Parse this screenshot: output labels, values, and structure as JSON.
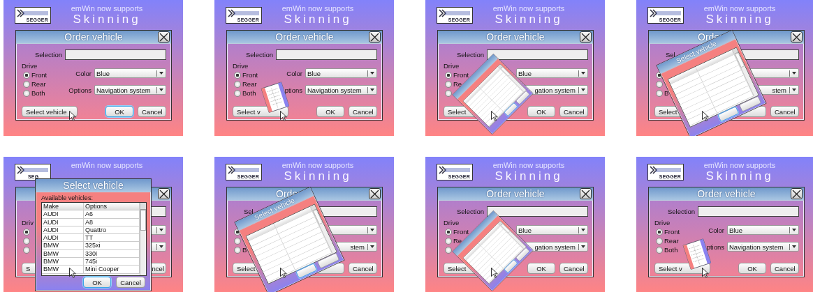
{
  "frames": [
    {
      "header": {
        "logo": "SEGGER",
        "line1": "emWin now supports",
        "line2": "Skinning"
      },
      "dialog": {
        "title": "Order vehicle",
        "selection_label": "Selection",
        "drive_label": "Drive",
        "drive_options": [
          {
            "label": "Front",
            "selected": true
          },
          {
            "label": "Rear",
            "selected": false
          },
          {
            "label": "Both",
            "selected": false
          }
        ],
        "color_label": "Color",
        "color_value": "Blue",
        "options_label": "Options",
        "options_value": "Navigation system",
        "buttons": [
          {
            "kind": "select",
            "label": "Select vehicle",
            "focused": false
          },
          {
            "kind": "ok",
            "label": "OK",
            "focused": true
          },
          {
            "kind": "cancel",
            "label": "Cancel",
            "focused": false
          }
        ]
      },
      "popup": {
        "kind": "none"
      }
    },
    {
      "header": {
        "logo": "SEGGER",
        "line1": "emWin now supports",
        "line2": "Skinning"
      },
      "dialog": {
        "title": "Order vehicle",
        "selection_label": "Selection",
        "drive_label": "Drive",
        "drive_options": [
          {
            "label": "Front",
            "selected": true
          },
          {
            "label": "Rear",
            "selected": false
          },
          {
            "label": "Both",
            "selected": false
          }
        ],
        "color_label": "Color",
        "color_value": "Blue",
        "options_label": "ptions",
        "options_value": "Navigation system",
        "buttons": [
          {
            "kind": "select",
            "label": "Select v",
            "focused": false
          },
          {
            "kind": "ok",
            "label": "OK",
            "focused": false
          },
          {
            "kind": "cancel",
            "label": "Cancel",
            "focused": false
          }
        ]
      },
      "popup": {
        "kind": "small"
      }
    },
    {
      "header": {
        "logo": "SEGGER",
        "line1": "emWin now supports",
        "line2": "Skinning"
      },
      "dialog": {
        "title": "Order vehicle",
        "selection_label": "Selection",
        "drive_label": "Drive",
        "drive_options": [
          {
            "label": "Front",
            "selected": true
          },
          {
            "label": "Re",
            "selected": false
          },
          {
            "selected": false
          }
        ],
        "color_value": "Blue",
        "options_value": "gation system",
        "buttons": [
          {
            "kind": "select",
            "label": "Select",
            "focused": false
          },
          {
            "kind": "ok",
            "label": "OK",
            "focused": false
          },
          {
            "kind": "cancel",
            "label": "Cancel",
            "focused": false
          }
        ]
      },
      "popup": {
        "kind": "steep"
      }
    },
    {
      "header": {
        "logo": "SEGGER",
        "line1": "emWin now supports",
        "line2": "Skinning"
      },
      "dialog": {
        "title": "Order",
        "selection_label": "Sel",
        "drive_options": [
          {
            "selected": true
          },
          {
            "selected": false
          },
          {
            "label": "B",
            "selected": false
          }
        ],
        "options_value": "stem",
        "buttons": [
          {
            "kind": "select",
            "label": "Select",
            "focused": false
          },
          {
            "kind": "cancel",
            "label": "Cancel",
            "focused": false
          }
        ]
      },
      "popup": {
        "kind": "tilted",
        "title": "Select vehicle"
      }
    },
    {
      "header": {
        "logo": "SEG",
        "line1": "emWin now supports"
      },
      "dialog": {
        "drive_label": "Driv",
        "drive_options": [
          {
            "selected": true
          },
          {
            "selected": false
          },
          {
            "selected": false
          }
        ],
        "buttons": [
          {
            "kind": "select",
            "label": "S",
            "focused": false
          },
          {
            "kind": "cancel",
            "label": "ncel",
            "focused": false
          }
        ]
      },
      "popup": {
        "kind": "full",
        "title": "Select vehicle",
        "list_label": "Available vehicles:",
        "columns": [
          "Make",
          "Options"
        ],
        "rows": [
          [
            "AUDI",
            "A6"
          ],
          [
            "AUDI",
            "A8"
          ],
          [
            "AUDI",
            "Quattro"
          ],
          [
            "AUDI",
            "TT"
          ],
          [
            "BMW",
            "325xi"
          ],
          [
            "BMW",
            "330i"
          ],
          [
            "BMW",
            "745i"
          ],
          [
            "BMW",
            "Mini Cooper"
          ]
        ],
        "buttons": [
          {
            "label": "OK",
            "focused": true
          },
          {
            "label": "Cancel",
            "focused": false
          }
        ]
      }
    },
    {
      "header": {
        "logo": "SEGGER",
        "line1": "emWin now supports",
        "line2": "Skinning"
      },
      "dialog": {
        "title": "Order",
        "selection_label": "Sel",
        "drive_options": [
          {
            "selected": true
          },
          {
            "selected": false
          },
          {
            "label": "B",
            "selected": false
          }
        ],
        "options_value": "stem",
        "buttons": [
          {
            "kind": "select",
            "label": "Select",
            "focused": false
          },
          {
            "kind": "cancel",
            "label": "Cancel",
            "focused": false
          }
        ]
      },
      "popup": {
        "kind": "tilted",
        "title": "Select vehicle"
      }
    },
    {
      "header": {
        "logo": "SEGGER",
        "line1": "emWin now supports",
        "line2": "Skinning"
      },
      "dialog": {
        "title": "Order vehicle",
        "selection_label": "Selection",
        "drive_label": "Drive",
        "drive_options": [
          {
            "label": "Front",
            "selected": true
          },
          {
            "label": "Re",
            "selected": false
          },
          {
            "selected": false
          }
        ],
        "color_value": "Blue",
        "options_value": "gation system",
        "buttons": [
          {
            "kind": "select",
            "label": "Select",
            "focused": false
          },
          {
            "kind": "ok",
            "label": "OK",
            "focused": false
          },
          {
            "kind": "cancel",
            "label": "Cancel",
            "focused": false
          }
        ]
      },
      "popup": {
        "kind": "steep"
      }
    },
    {
      "header": {
        "logo": "SEGGER",
        "line1": "emWin now supports",
        "line2": "Skinning"
      },
      "dialog": {
        "title": "Order vehicle",
        "selection_label": "Selection",
        "drive_label": "Drive",
        "drive_options": [
          {
            "label": "Front",
            "selected": true
          },
          {
            "label": "Rear",
            "selected": false
          },
          {
            "label": "Both",
            "selected": false
          }
        ],
        "color_label": "Color",
        "color_value": "Blue",
        "options_label": "ptions",
        "options_value": "Navigation system",
        "buttons": [
          {
            "kind": "select",
            "label": "Select v",
            "focused": false
          },
          {
            "kind": "ok",
            "label": "OK",
            "focused": false
          },
          {
            "kind": "cancel",
            "label": "Cancel",
            "focused": false
          }
        ]
      },
      "popup": {
        "kind": "small"
      }
    }
  ]
}
